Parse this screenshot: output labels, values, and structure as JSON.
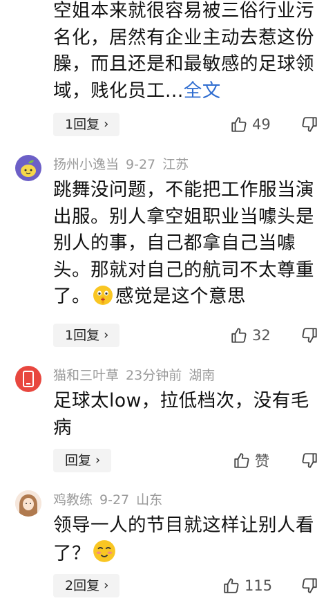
{
  "comments": [
    {
      "text": "空姐本来就很容易被三俗行业污名化，居然有企业主动去惹这份臊，而且还是和最敏感的足球领域，贱化员工...",
      "full_text_link": "全文",
      "reply_label": "1回复",
      "like_count": "49"
    },
    {
      "username": "扬州小逸当",
      "date": "9-27",
      "location": "江苏",
      "text_before_emoji": "跳舞没问题，不能把工作服当演出服。别人拿空姐职业当噱头是别人的事，自己都拿自己当噱头。那就对自己的航司不太尊重了。",
      "text_after_emoji": "感觉是这个意思",
      "reply_label": "1回复",
      "like_count": "32"
    },
    {
      "username": "猫和三叶草",
      "date": "23分钟前",
      "location": "湖南",
      "text": "足球太low，拉低档次，没有毛病",
      "reply_label": "回复",
      "like_count": "赞"
    },
    {
      "username": "鸡教练",
      "date": "9-27",
      "location": "山东",
      "text": "领导一人的节目就这样让别人看了？",
      "reply_label": "2回复",
      "like_count": "115"
    }
  ],
  "icons": {
    "like": "thumbs-up-icon",
    "dislike": "thumbs-down-icon",
    "reply_chevron": "chevron-right-icon"
  },
  "colors": {
    "link": "#2f6dd0",
    "meta": "#9a9a9a",
    "reply_bg": "#f3f3f3"
  }
}
